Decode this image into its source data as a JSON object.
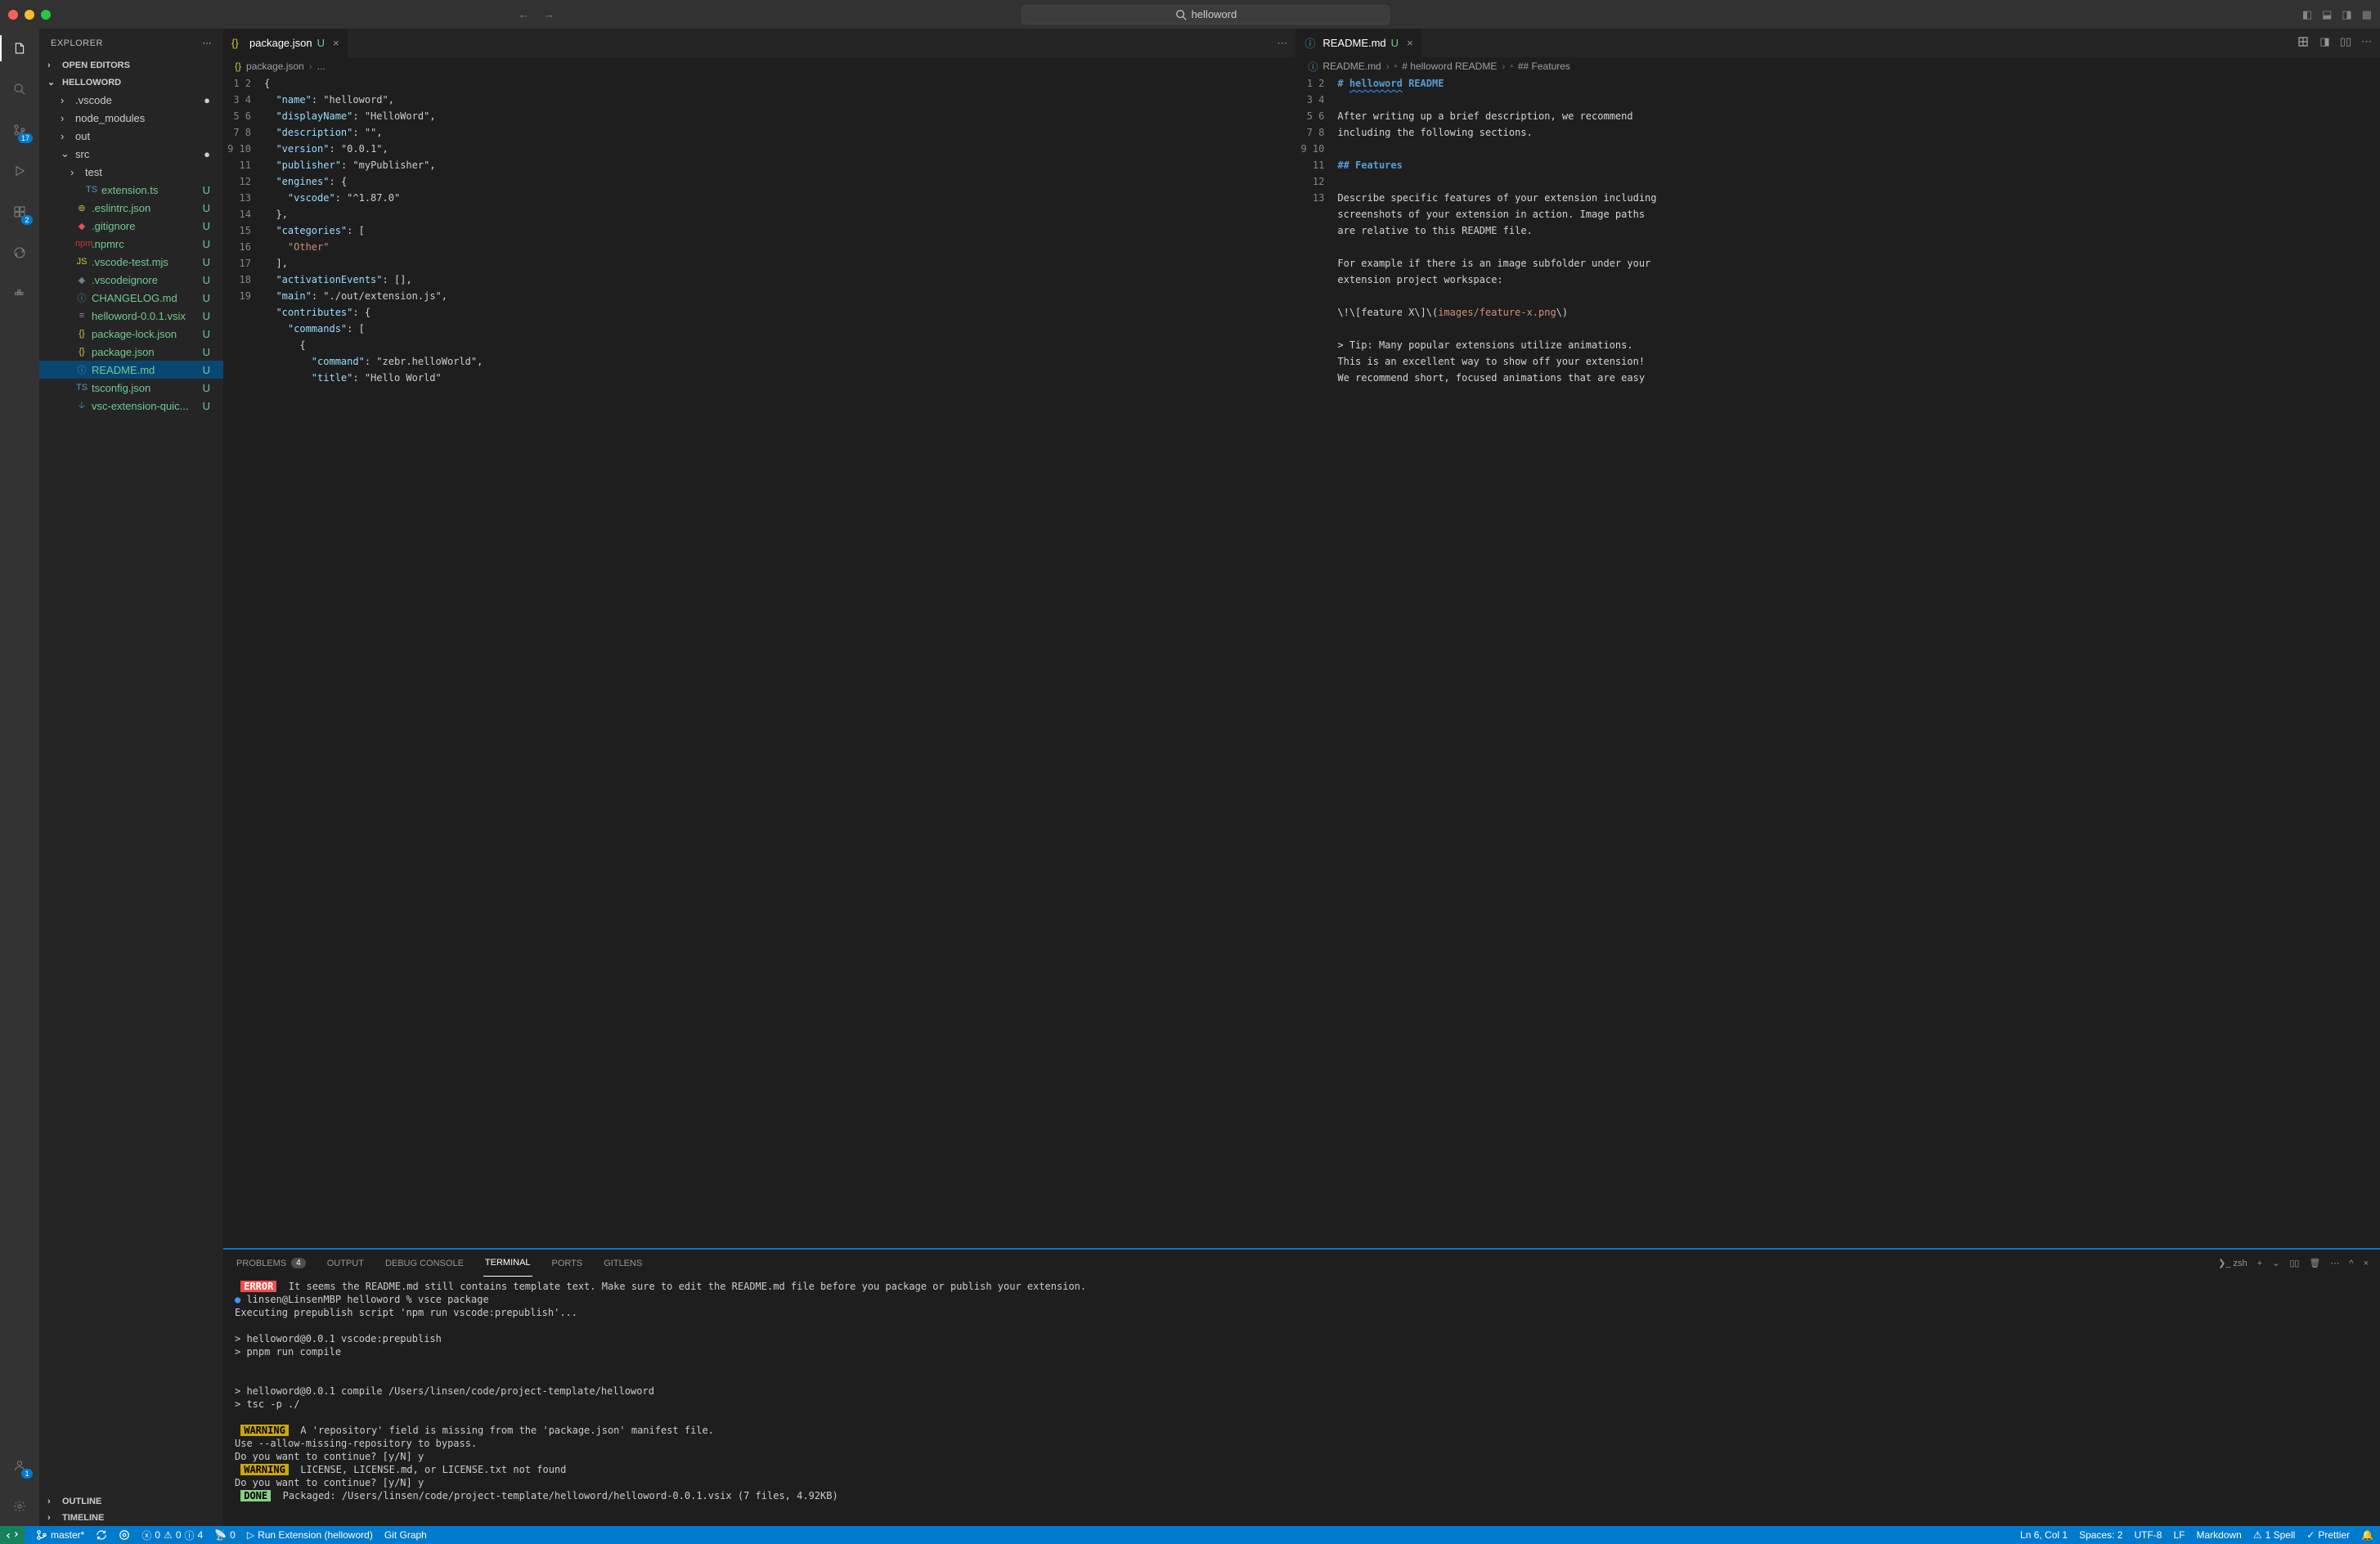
{
  "titlebar": {
    "search_text": "helloword"
  },
  "sidebar": {
    "title": "EXPLORER",
    "sections": {
      "open_editors": "OPEN EDITORS",
      "workspace": "HELLOWORD",
      "outline": "OUTLINE",
      "timeline": "TIMELINE"
    },
    "tree": [
      {
        "type": "folder",
        "name": ".vscode",
        "depth": 1,
        "git": "●",
        "expanded": false
      },
      {
        "type": "folder",
        "name": "node_modules",
        "depth": 1,
        "git": "",
        "expanded": false
      },
      {
        "type": "folder",
        "name": "out",
        "depth": 1,
        "git": "",
        "expanded": false
      },
      {
        "type": "folder",
        "name": "src",
        "depth": 1,
        "git": "●",
        "expanded": true
      },
      {
        "type": "folder",
        "name": "test",
        "depth": 2,
        "git": "",
        "expanded": false
      },
      {
        "type": "file",
        "name": "extension.ts",
        "depth": 2,
        "git": "U",
        "icon": "ts"
      },
      {
        "type": "file",
        "name": ".eslintrc.json",
        "depth": 1,
        "git": "U",
        "icon": "json-cfg"
      },
      {
        "type": "file",
        "name": ".gitignore",
        "depth": 1,
        "git": "U",
        "icon": "git"
      },
      {
        "type": "file",
        "name": ".npmrc",
        "depth": 1,
        "git": "U",
        "icon": "npm"
      },
      {
        "type": "file",
        "name": ".vscode-test.mjs",
        "depth": 1,
        "git": "U",
        "icon": "js"
      },
      {
        "type": "file",
        "name": ".vscodeignore",
        "depth": 1,
        "git": "U",
        "icon": "cfg"
      },
      {
        "type": "file",
        "name": "CHANGELOG.md",
        "depth": 1,
        "git": "U",
        "icon": "info"
      },
      {
        "type": "file",
        "name": "helloword-0.0.1.vsix",
        "depth": 1,
        "git": "U",
        "icon": "vsix"
      },
      {
        "type": "file",
        "name": "package-lock.json",
        "depth": 1,
        "git": "U",
        "icon": "json"
      },
      {
        "type": "file",
        "name": "package.json",
        "depth": 1,
        "git": "U",
        "icon": "json"
      },
      {
        "type": "file",
        "name": "README.md",
        "depth": 1,
        "git": "U",
        "icon": "info",
        "selected": true
      },
      {
        "type": "file",
        "name": "tsconfig.json",
        "depth": 1,
        "git": "U",
        "icon": "ts-cfg"
      },
      {
        "type": "file",
        "name": "vsc-extension-quic...",
        "depth": 1,
        "git": "U",
        "icon": "md"
      }
    ]
  },
  "activitybar": {
    "scm_badge": "17",
    "ext_badge": "2",
    "acct_badge": "1"
  },
  "left_editor": {
    "tab_label": "package.json",
    "tab_git": "U",
    "breadcrumb": [
      "package.json",
      "..."
    ],
    "lines": [
      "{",
      "  \"name\": \"helloword\",",
      "  \"displayName\": \"HelloWord\",",
      "  \"description\": \"\",",
      "  \"version\": \"0.0.1\",",
      "  \"publisher\": \"myPublisher\",",
      "  \"engines\": {",
      "    \"vscode\": \"^1.87.0\"",
      "  },",
      "  \"categories\": [",
      "    \"Other\"",
      "  ],",
      "  \"activationEvents\": [],",
      "  \"main\": \"./out/extension.js\",",
      "  \"contributes\": {",
      "    \"commands\": [",
      "      {",
      "        \"command\": \"zebr.helloWorld\",",
      "        \"title\": \"Hello World\""
    ]
  },
  "right_editor": {
    "tab_label": "README.md",
    "tab_git": "U",
    "breadcrumb": [
      "README.md",
      "# helloword README",
      "## Features"
    ],
    "lines_rendered": true
  },
  "panel": {
    "tabs": {
      "problems": "PROBLEMS",
      "problems_count": "4",
      "output": "OUTPUT",
      "debug": "DEBUG CONSOLE",
      "terminal": "TERMINAL",
      "ports": "PORTS",
      "gitlens": "GITLENS"
    },
    "shell_label": "zsh",
    "terminal_lines": [
      {
        "tag": "ERROR",
        "text": "It seems the README.md still contains template text. Make sure to edit the README.md file before you package or publish your extension."
      },
      {
        "prompt": true,
        "text": "linsen@LinsenMBP helloword % vsce package"
      },
      {
        "text": "Executing prepublish script 'npm run vscode:prepublish'..."
      },
      {
        "blank": true
      },
      {
        "text": "> helloword@0.0.1 vscode:prepublish"
      },
      {
        "text": "> pnpm run compile"
      },
      {
        "blank": true
      },
      {
        "blank": true
      },
      {
        "text": "> helloword@0.0.1 compile /Users/linsen/code/project-template/helloword"
      },
      {
        "text": "> tsc -p ./"
      },
      {
        "blank": true
      },
      {
        "tag": "WARNING",
        "text": "A 'repository' field is missing from the 'package.json' manifest file."
      },
      {
        "text": "Use --allow-missing-repository to bypass."
      },
      {
        "text": "Do you want to continue? [y/N] y"
      },
      {
        "tag": "WARNING",
        "text": "LICENSE, LICENSE.md, or LICENSE.txt not found"
      },
      {
        "text": "Do you want to continue? [y/N] y"
      },
      {
        "tag": "DONE",
        "text": "Packaged: /Users/linsen/code/project-template/helloword/helloword-0.0.1.vsix (7 files, 4.92KB)"
      }
    ]
  },
  "statusbar": {
    "branch": "master*",
    "errors": "0",
    "warnings": "0",
    "info": "4",
    "ports": "0",
    "launch": "Run Extension (helloword)",
    "gitgraph": "Git Graph",
    "cursor": "Ln 6, Col 1",
    "spaces": "Spaces: 2",
    "encoding": "UTF-8",
    "eol": "LF",
    "lang": "Markdown",
    "spell": "1 Spell",
    "prettier": "Prettier"
  }
}
